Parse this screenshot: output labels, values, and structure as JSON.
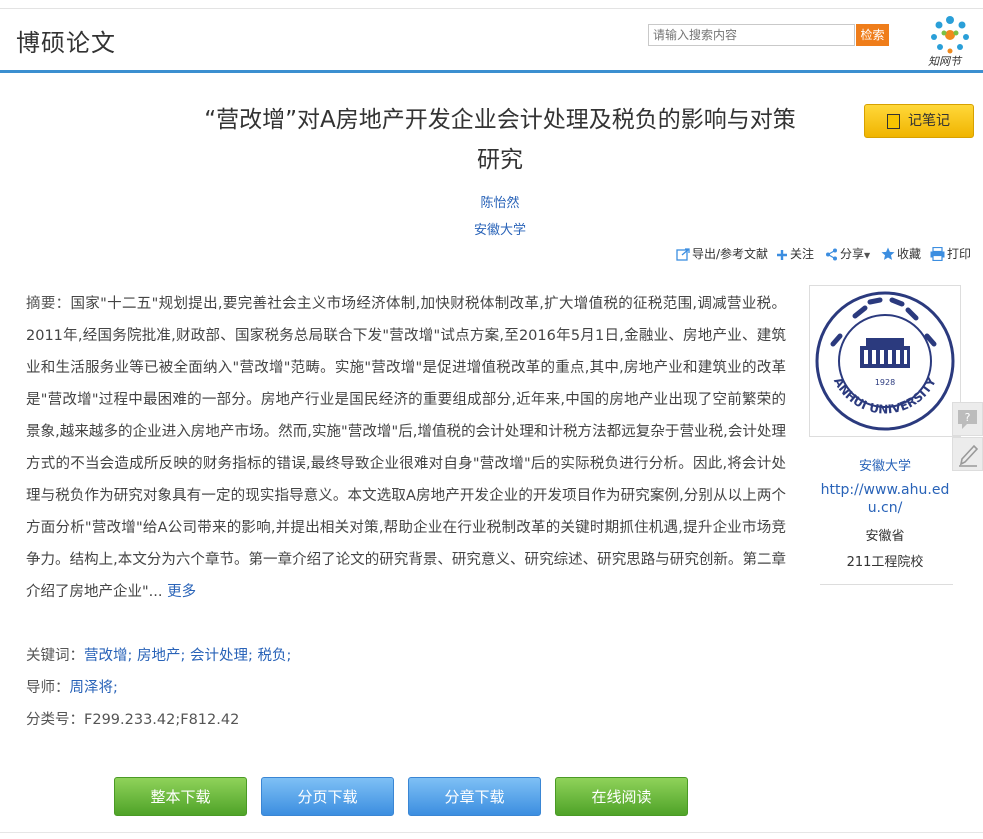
{
  "header": {
    "brand": "博硕论文",
    "search_placeholder": "请输入搜索内容",
    "search_button": "检索",
    "logo_text": "知网节"
  },
  "paper": {
    "title_line1": "“营改增”对A房地产开发企业会计处理及税负的影响与对策",
    "title_line2": "研究",
    "author": "陈怡然",
    "institution": "安徽大学",
    "note_button": "记笔记"
  },
  "toolbar": {
    "export": "导出/参考文献",
    "follow": "关注",
    "share": "分享",
    "favorite": "收藏",
    "print": "打印"
  },
  "abstract": {
    "label": "摘要：",
    "text": "国家\"十二五\"规划提出,要完善社会主义市场经济体制,加快财税体制改革,扩大增值税的征税范围,调减营业税。2011年,经国务院批准,财政部、国家税务总局联合下发\"营改增\"试点方案,至2016年5月1日,金融业、房地产业、建筑业和生活服务业等已被全面纳入\"营改增\"范畴。实施\"营改增\"是促进增值税改革的重点,其中,房地产业和建筑业的改革是\"营改增\"过程中最困难的一部分。房地产行业是国民经济的重要组成部分,近年来,中国的房地产业出现了空前繁荣的景象,越来越多的企业进入房地产市场。然而,实施\"营改增\"后,增值税的会计处理和计税方法都远复杂于营业税,会计处理方式的不当会造成所反映的财务指标的错误,最终导致企业很难对自身\"营改增\"后的实际税负进行分析。因此,将会计处理与税负作为研究对象具有一定的现实指导意义。本文选取A房地产开发企业的开发项目作为研究案例,分别从以上两个方面分析\"营改增\"给A公司带来的影响,并提出相关对策,帮助企业在行业税制改革的关键时期抓住机遇,提升企业市场竞争力。结构上,本文分为六个章节。第一章介绍了论文的研究背景、研究意义、研究综述、研究思路与研究创新。第二章介绍了房地产企业\"...",
    "more": "更多"
  },
  "meta": {
    "keywords_label": "关键词：",
    "keywords": [
      "营改增;",
      "房地产;",
      "会计处理;",
      "税负;"
    ],
    "advisor_label": "导师：",
    "advisor": "周泽将;",
    "class_label": "分类号：",
    "class_value": "F299.233.42;F812.42"
  },
  "university": {
    "name": "安徽大学",
    "url": "http://www.ahu.edu.cn/",
    "province": "安徽省",
    "type": "211工程院校",
    "seal_text": "ANHUI UNIVERSITY",
    "seal_year": "1928"
  },
  "buttons": {
    "full_download": "整本下载",
    "page_download": "分页下载",
    "chapter_download": "分章下载",
    "online_read": "在线阅读"
  },
  "colors": {
    "link": "#2963b8",
    "accent_blue": "#3b8fd0",
    "search_orange": "#ef7d1a",
    "note_yellow": "#f6c400",
    "button_green": "#4fa328",
    "button_blue": "#3c8ee0"
  }
}
